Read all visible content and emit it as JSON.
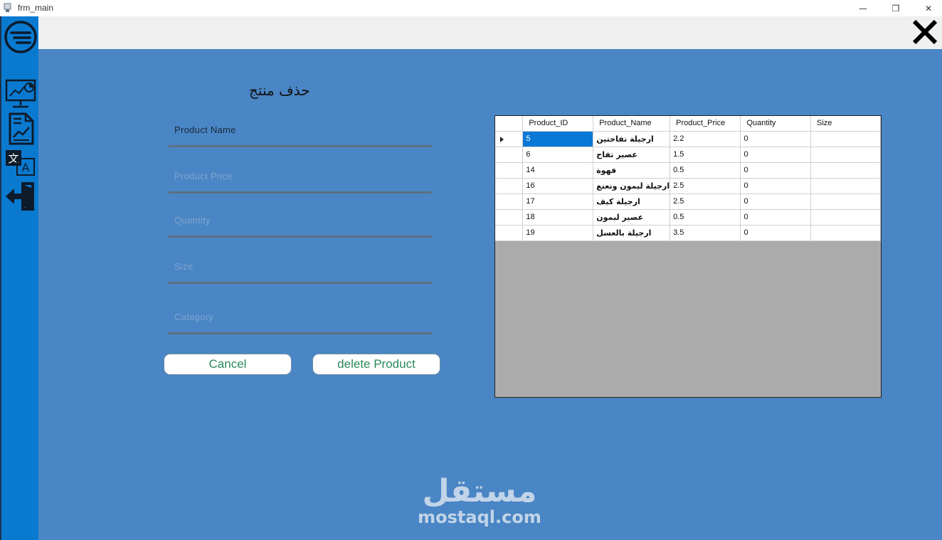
{
  "window": {
    "title": "frm_main",
    "minimize_glyph": "—",
    "restore_glyph": "❐",
    "close_glyph": "✕"
  },
  "sidebar": {
    "items": [
      {
        "icon": "menu-icon"
      },
      {
        "icon": "dashboard-icon"
      },
      {
        "icon": "report-icon"
      },
      {
        "icon": "translate-icon"
      },
      {
        "icon": "logout-icon"
      }
    ]
  },
  "form": {
    "title": "حذف منتج",
    "fields": {
      "product_name": {
        "value": "Product Name"
      },
      "product_price": {
        "placeholder": "Product Price"
      },
      "quantity": {
        "placeholder": "Quantity"
      },
      "size": {
        "placeholder": "Size"
      },
      "category": {
        "placeholder": "Category"
      }
    },
    "buttons": {
      "cancel": "Cancel",
      "delete": "delete Product"
    }
  },
  "grid": {
    "columns": [
      "Product_ID",
      "Product_Name",
      "Product_Price",
      "Quantity",
      "Size"
    ],
    "rows": [
      {
        "id": "5",
        "name": "ارجيلة تفاحتين",
        "price": "2.2",
        "qty": "0",
        "size": ""
      },
      {
        "id": "6",
        "name": "عصير تفاح",
        "price": "1.5",
        "qty": "0",
        "size": ""
      },
      {
        "id": "14",
        "name": "قهوة",
        "price": "0.5",
        "qty": "0",
        "size": ""
      },
      {
        "id": "16",
        "name": "ارجيلة ليمون ونعنع",
        "price": "2.5",
        "qty": "0",
        "size": ""
      },
      {
        "id": "17",
        "name": "ارجيلة كيف",
        "price": "2.5",
        "qty": "0",
        "size": ""
      },
      {
        "id": "18",
        "name": "عصير ليمون",
        "price": "0.5",
        "qty": "0",
        "size": ""
      },
      {
        "id": "19",
        "name": "ارجيلة بالعسل",
        "price": "3.5",
        "qty": "0",
        "size": ""
      }
    ],
    "selected_row": 0
  },
  "watermark": {
    "arabic": "مستقل",
    "latin": "mostaql.com"
  },
  "colors": {
    "main_bg": "#4a86c5",
    "sidebar_bg": "#0a7ad0",
    "button_text": "#2a8a5a",
    "selection": "#0a78d7"
  }
}
